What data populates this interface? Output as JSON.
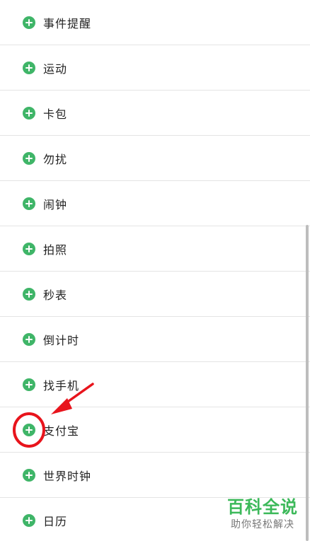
{
  "list": {
    "items": [
      {
        "label": "事件提醒"
      },
      {
        "label": "运动"
      },
      {
        "label": "卡包"
      },
      {
        "label": "勿扰"
      },
      {
        "label": "闹钟"
      },
      {
        "label": "拍照"
      },
      {
        "label": "秒表"
      },
      {
        "label": "倒计时"
      },
      {
        "label": "找手机"
      },
      {
        "label": "支付宝"
      },
      {
        "label": "世界时钟"
      },
      {
        "label": "日历"
      }
    ]
  },
  "icons": {
    "add": "plus-circle-icon"
  },
  "colors": {
    "add_icon": "#3fb568",
    "divider": "#e4e4e4",
    "annotation": "#e8141c",
    "watermark": "#3cb95a"
  },
  "watermark": {
    "title": "百科全说",
    "subtitle": "助你轻松解决"
  }
}
